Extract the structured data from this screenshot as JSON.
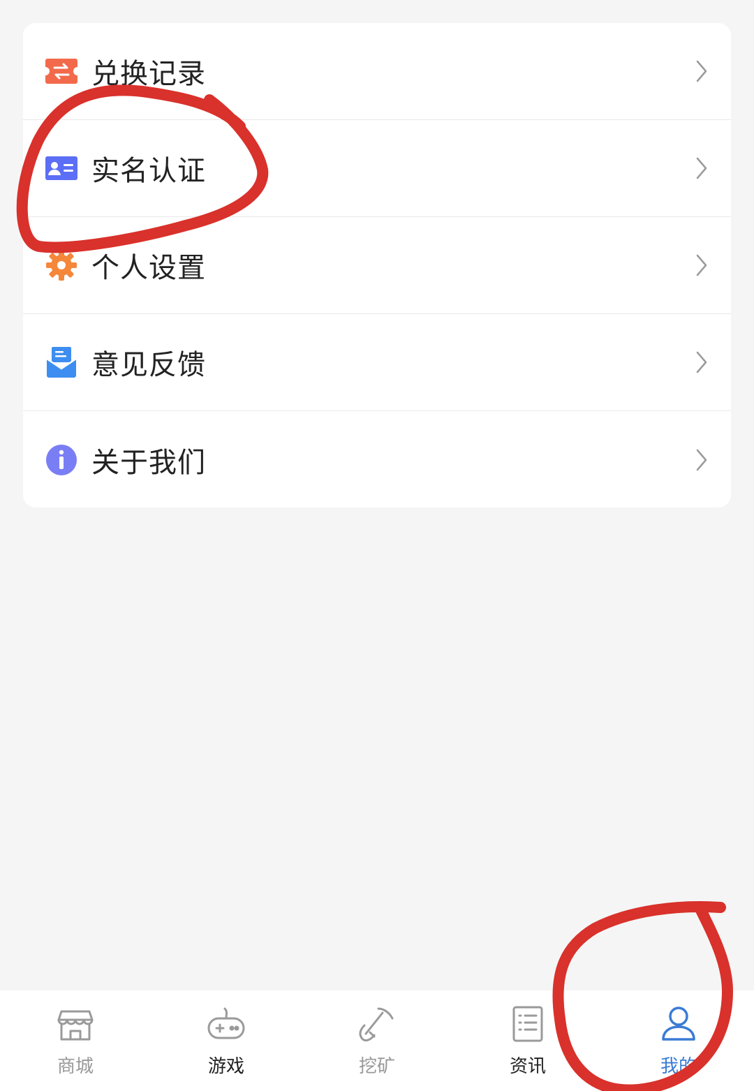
{
  "menu": {
    "items": [
      {
        "label": "兑换记录",
        "icon": "exchange-icon",
        "icon_color": "#f26a4b"
      },
      {
        "label": "实名认证",
        "icon": "id-card-icon",
        "icon_color": "#5b6ef5"
      },
      {
        "label": "个人设置",
        "icon": "gear-icon",
        "icon_color": "#f5873a"
      },
      {
        "label": "意见反馈",
        "icon": "feedback-mail-icon",
        "icon_color": "#3d8ef0"
      },
      {
        "label": "关于我们",
        "icon": "info-icon",
        "icon_color": "#7a7ef5"
      }
    ]
  },
  "tabbar": {
    "tabs": [
      {
        "label": "商城",
        "icon": "store-icon",
        "state": "inactive"
      },
      {
        "label": "游戏",
        "icon": "gamepad-icon",
        "state": "inactive"
      },
      {
        "label": "挖矿",
        "icon": "pickaxe-icon",
        "state": "inactive"
      },
      {
        "label": "资讯",
        "icon": "news-list-icon",
        "state": "inactive"
      },
      {
        "label": "我的",
        "icon": "user-icon",
        "state": "active"
      }
    ],
    "active_color": "#3a7bd5",
    "inactive_color": "#999999"
  },
  "annotation_color": "#d9312b"
}
